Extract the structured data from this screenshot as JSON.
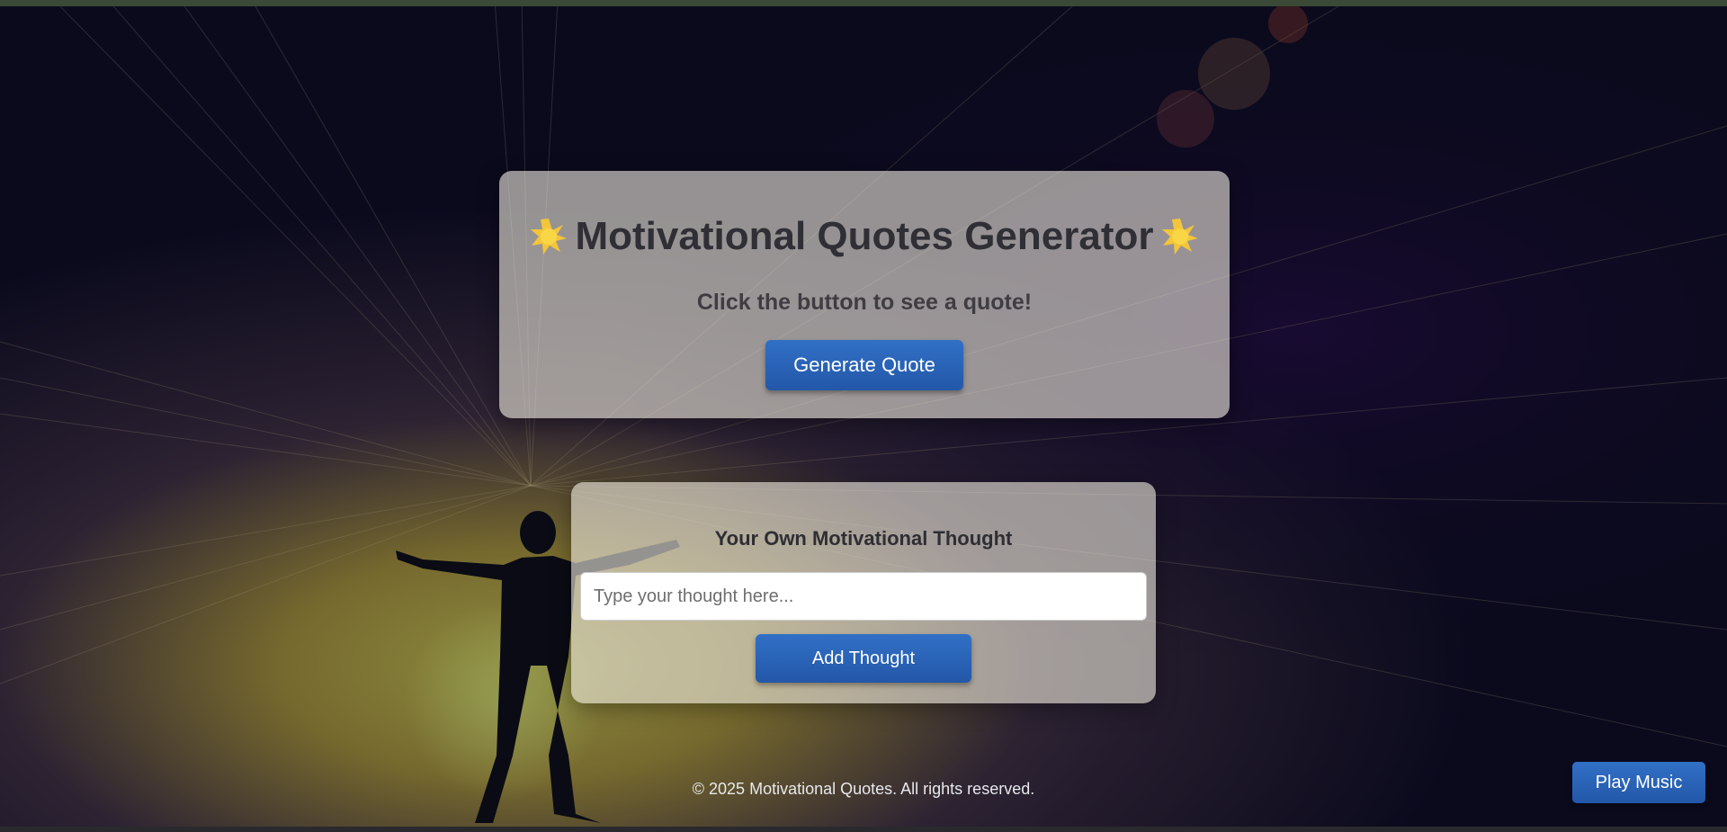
{
  "quote_card": {
    "title": "Motivational Quotes Generator",
    "subtitle": "Click the button to see a quote!",
    "button_label": "Generate Quote",
    "icon": "star-icon"
  },
  "thought_card": {
    "title": "Your Own Motivational Thought",
    "input_value": "",
    "input_placeholder": "Type your thought here...",
    "button_label": "Add Thought"
  },
  "footer": {
    "text": "© 2025 Motivational Quotes. All rights reserved."
  },
  "music": {
    "button_label": "Play Music"
  },
  "colors": {
    "accent": "#2d65bb",
    "background": "#0c0a1c",
    "glow": "#8a7a30"
  }
}
